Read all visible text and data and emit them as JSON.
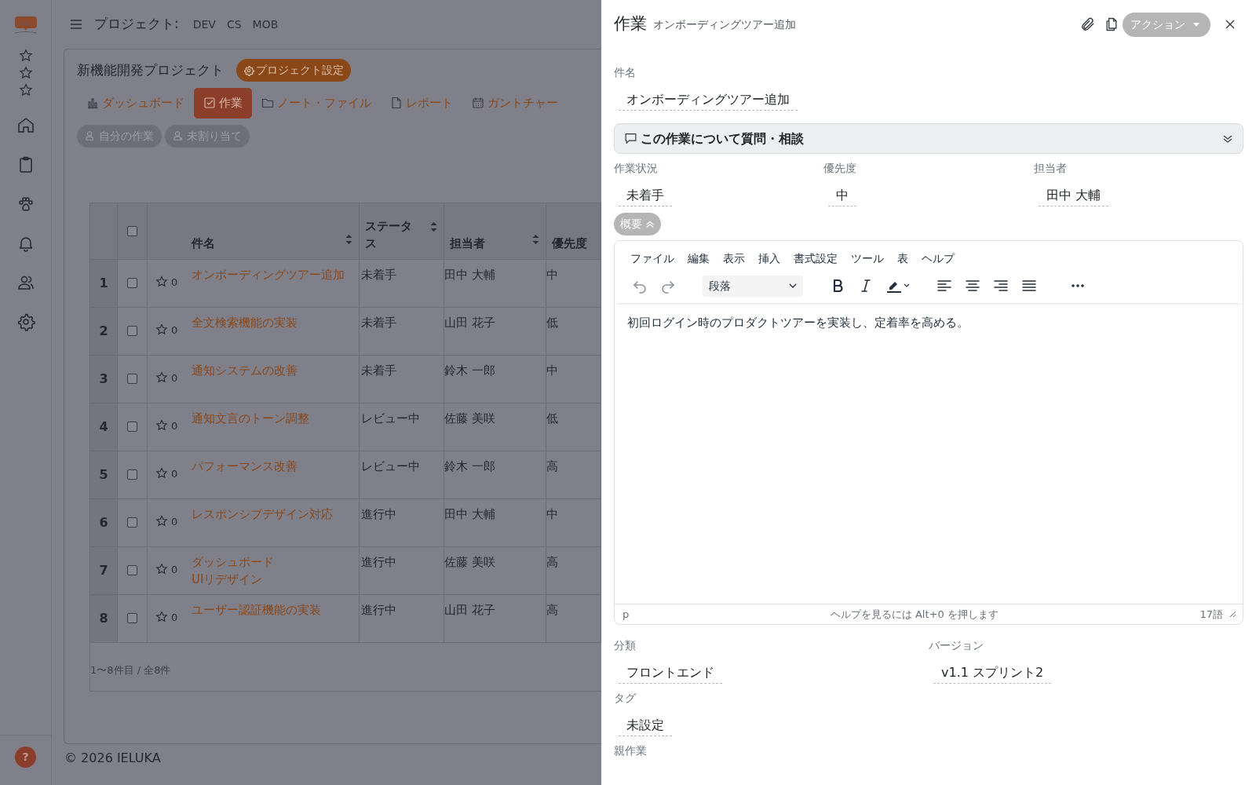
{
  "sidebar": {
    "help": "?"
  },
  "topbar": {
    "label": "プロジェクト:",
    "projects": [
      "DEV",
      "CS",
      "MOB"
    ]
  },
  "project": {
    "title": "新機能開発プロジェクト",
    "settings_button": "プロジェクト設定"
  },
  "tabs": [
    {
      "label": "ダッシュボード",
      "kind": "chart",
      "selected": false
    },
    {
      "label": "作業",
      "kind": "check",
      "selected": true
    },
    {
      "label": "ノート・ファイル",
      "kind": "folder",
      "selected": false
    },
    {
      "label": "レポート",
      "kind": "file",
      "selected": false
    },
    {
      "label": "ガントチャー",
      "kind": "calendar",
      "selected": false
    }
  ],
  "filters": [
    {
      "label": "自分の作業",
      "kind": "person"
    },
    {
      "label": "未割り当て",
      "kind": "unassigned"
    }
  ],
  "table": {
    "columns": [
      "件名",
      "ステータス",
      "担当者",
      "優先度"
    ],
    "select_all": false,
    "rows": [
      {
        "number": "1",
        "checked": false,
        "favorite_count": "0",
        "title": "オンボーディングツアー追加",
        "status": "未着手",
        "assignee": "田中 大輔",
        "priority": "中"
      },
      {
        "number": "2",
        "checked": false,
        "favorite_count": "0",
        "title": "全文検索機能の実装",
        "status": "未着手",
        "assignee": "山田 花子",
        "priority": "低"
      },
      {
        "number": "3",
        "checked": false,
        "favorite_count": "0",
        "title": "通知システムの改善",
        "status": "未着手",
        "assignee": "鈴木 一郎",
        "priority": "中"
      },
      {
        "number": "4",
        "checked": false,
        "favorite_count": "0",
        "title": "通知文言のトーン調整",
        "status": "レビュー中",
        "assignee": "佐藤 美咲",
        "priority": "低"
      },
      {
        "number": "5",
        "checked": false,
        "favorite_count": "0",
        "title": "パフォーマンス改善",
        "status": "レビュー中",
        "assignee": "鈴木 一郎",
        "priority": "高"
      },
      {
        "number": "6",
        "checked": false,
        "favorite_count": "0",
        "title": "レスポンシブデザイン対応",
        "status": "進行中",
        "assignee": "田中 大輔",
        "priority": "中"
      },
      {
        "number": "7",
        "checked": false,
        "favorite_count": "0",
        "title": "ダッシュボード UIリデザイン",
        "status": "進行中",
        "assignee": "佐藤 美咲",
        "priority": "高"
      },
      {
        "number": "8",
        "checked": false,
        "favorite_count": "0",
        "title": "ユーザー認証機能の実装",
        "status": "進行中",
        "assignee": "山田 花子",
        "priority": "高"
      }
    ]
  },
  "pagination": "1〜8件目 / 全8件",
  "footer": "© 2026 IELUKA",
  "panel": {
    "title": "作業",
    "subtitle": "オンボーディングツアー追加",
    "action_button": "アクション",
    "name_field": {
      "label": "件名",
      "value": "オンボーディングツアー追加"
    },
    "discussion": {
      "label": "この作業について質問・相談",
      "expanded": false
    },
    "status_fields": [
      {
        "label": "作業状況",
        "value": "未着手"
      },
      {
        "label": "優先度",
        "value": "中"
      },
      {
        "label": "担当者",
        "value": "田中 大輔"
      }
    ],
    "summary_toggle": {
      "label": "概要",
      "expanded": true
    },
    "editor": {
      "menu": [
        "ファイル",
        "編集",
        "表示",
        "挿入",
        "書式設定",
        "ツール",
        "表",
        "ヘルプ"
      ],
      "block_format": "段落",
      "content": "初回ログイン時のプロダクトツアーを実装し、定着率を高める。",
      "path": "p",
      "help": "ヘルプを見るには Alt+0 を押します",
      "word_count": "17語"
    },
    "bottom_fields": [
      {
        "label": "分類",
        "value": "フロントエンド"
      },
      {
        "label": "バージョン",
        "value": "v1.1 スプリント2"
      }
    ],
    "tag_field": {
      "label": "タグ",
      "value": "未設定"
    },
    "parent_label": "親作業"
  }
}
